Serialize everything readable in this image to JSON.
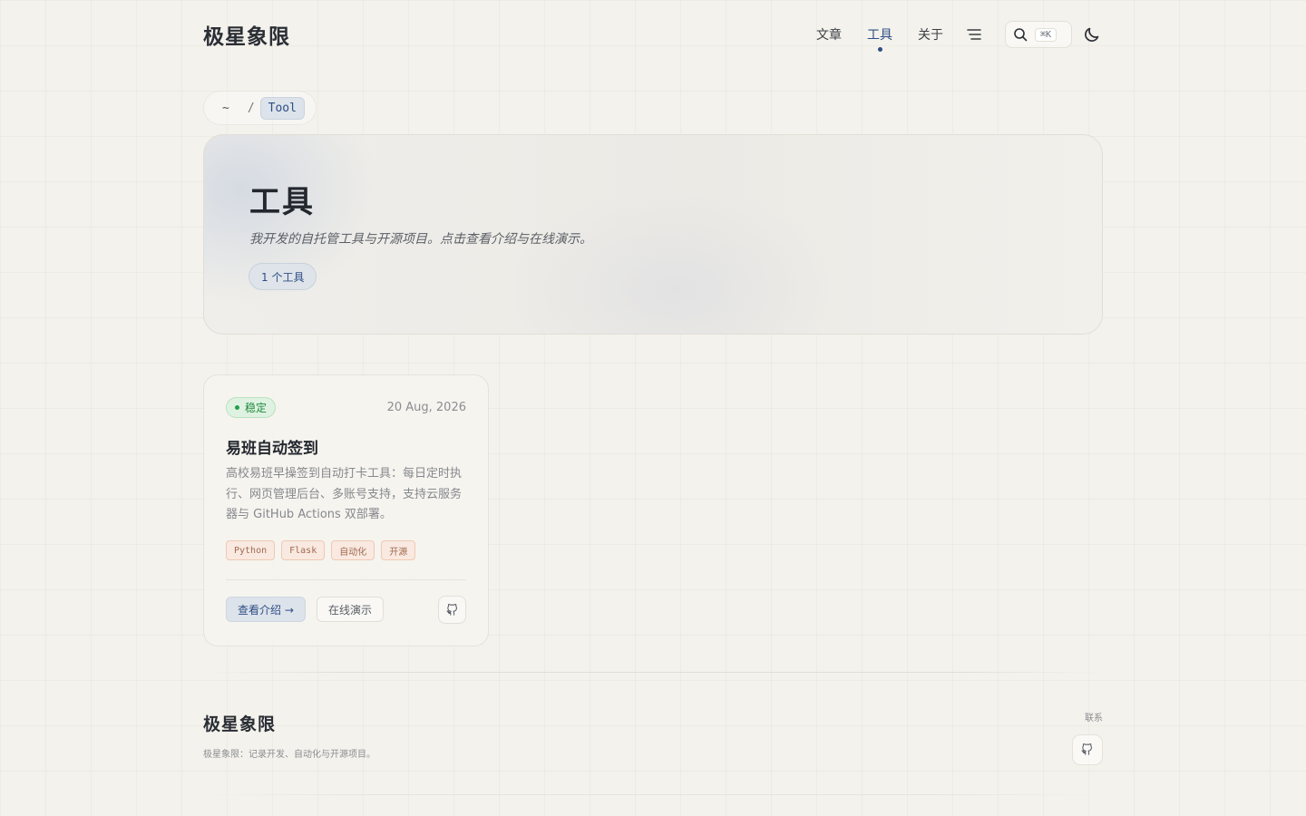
{
  "header": {
    "logo": "极星象限",
    "nav": [
      {
        "label": "文章",
        "active": false
      },
      {
        "label": "工具",
        "active": true
      },
      {
        "label": "关于",
        "active": false
      }
    ],
    "search_shortcut": "⌘K"
  },
  "breadcrumb": {
    "home": "~",
    "separator": "/",
    "current": "Tool"
  },
  "hero": {
    "title": "工具",
    "description": "我开发的自托管工具与开源项目。点击查看介绍与在线演示。",
    "count": "1 个工具"
  },
  "card": {
    "status": "稳定",
    "date": "20 Aug, 2026",
    "title": "易班自动签到",
    "description": "高校易班早操签到自动打卡工具：每日定时执行、网页管理后台、多账号支持，支持云服务器与 GitHub Actions 双部署。",
    "tags": [
      "Python",
      "Flask",
      "自动化",
      "开源"
    ],
    "intro_label": "查看介绍 →",
    "demo_label": "在线演示"
  },
  "footer": {
    "logo": "极星象限",
    "description": "极星象限：记录开发、自动化与开源项目。",
    "contact_label": "联系"
  },
  "colors": {
    "accent": "#2d4e86",
    "status_green": "#1f8a3c",
    "tag_orange": "#a06a52",
    "background": "#f4f2ec"
  }
}
